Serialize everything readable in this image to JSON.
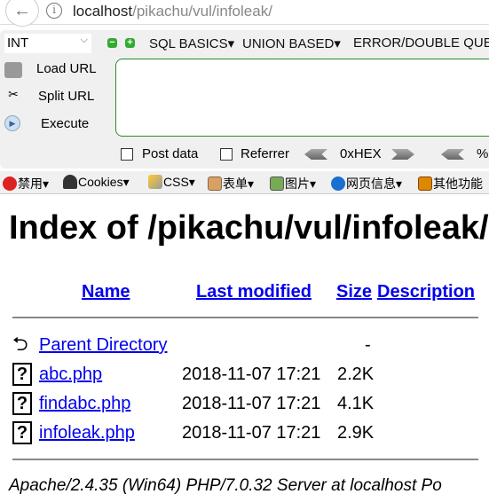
{
  "browser": {
    "url_host": "localhost",
    "url_path": "/pikachu/vul/infoleak/"
  },
  "hackbar": {
    "select_value": "INT",
    "menus": [
      "SQL BASICS▾",
      "UNION BASED▾",
      "ERROR/DOUBLE QUE"
    ],
    "load_url": "Load URL",
    "split_url": "Split URL",
    "execute": "Execute",
    "post_data": "Post data",
    "referrer": "Referrer",
    "hex": "0xHEX",
    "percent": "%"
  },
  "toolbar": {
    "items": [
      "禁用▾",
      "Cookies▾",
      "CSS▾",
      "表单▾",
      "图片▾",
      "网页信息▾",
      "其他功能"
    ]
  },
  "page": {
    "title": "Index of /pikachu/vul/infoleak/",
    "headers": {
      "name": "Name",
      "modified": "Last modified",
      "size": "Size",
      "description": "Description"
    },
    "rows": [
      {
        "name": "Parent Directory",
        "modified": "",
        "size": "-",
        "icon": "back-icon"
      },
      {
        "name": "abc.php",
        "modified": "2018-11-07 17:21",
        "size": "2.2K",
        "icon": "unknown-file-icon"
      },
      {
        "name": "findabc.php",
        "modified": "2018-11-07 17:21",
        "size": "4.1K",
        "icon": "unknown-file-icon"
      },
      {
        "name": "infoleak.php",
        "modified": "2018-11-07 17:21",
        "size": "2.9K",
        "icon": "unknown-file-icon"
      }
    ],
    "address": "Apache/2.4.35 (Win64) PHP/7.0.32 Server at localhost Po"
  }
}
